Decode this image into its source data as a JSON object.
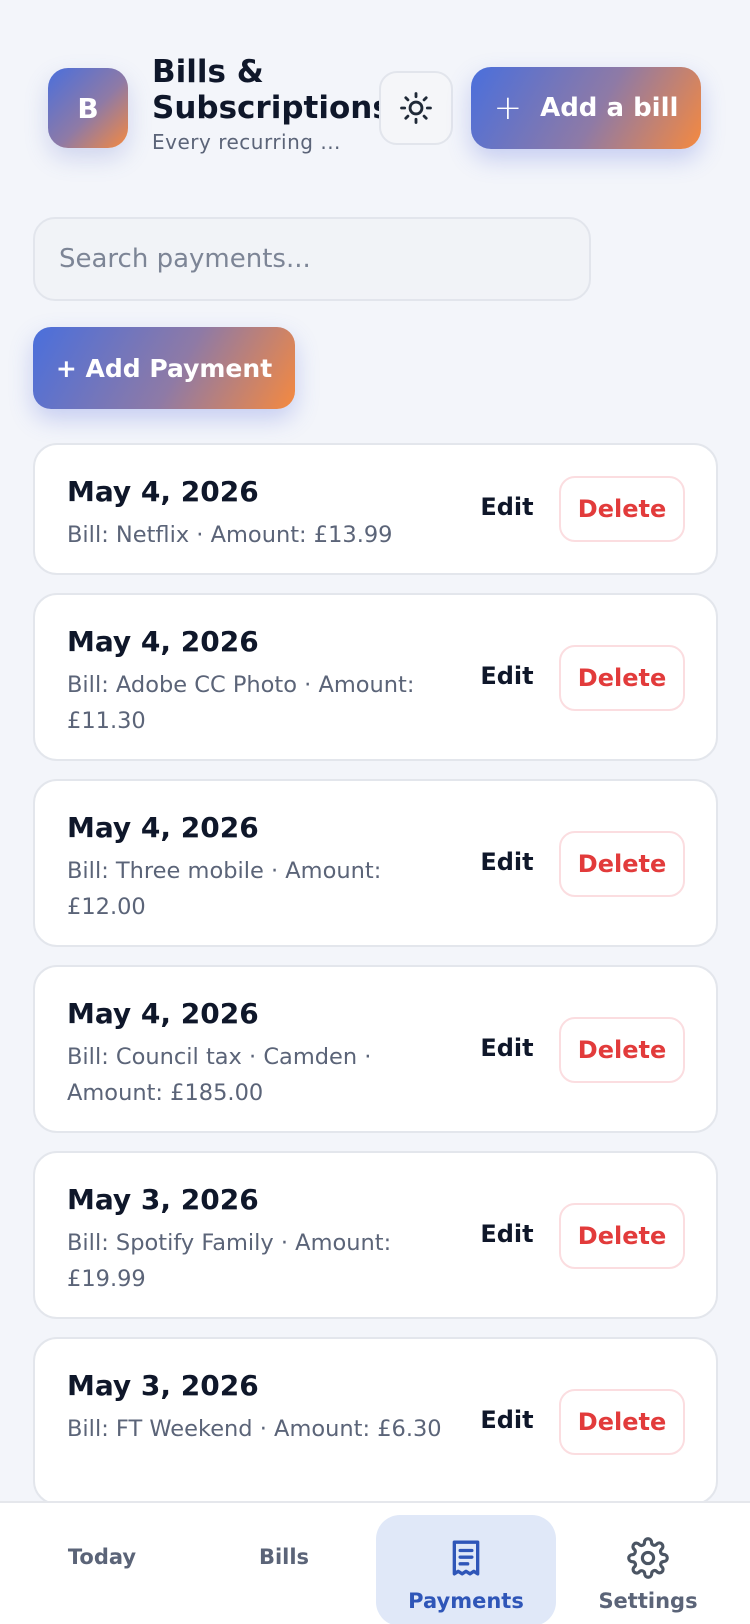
{
  "header": {
    "logo_letter": "B",
    "title": "Bills & Subscriptions",
    "subtitle": "Every recurring ...",
    "theme_toggle_icon": "sun-icon",
    "add_bill_label": "Add a bill"
  },
  "search": {
    "placeholder": "Search payments...",
    "value": ""
  },
  "add_payment_label": "+ Add Payment",
  "payments": [
    {
      "date": "May 4, 2026",
      "detail": "Bill: Netflix · Amount: £13.99",
      "edit": "Edit",
      "delete": "Delete"
    },
    {
      "date": "May 4, 2026",
      "detail": "Bill: Adobe CC Photo · Amount: £11.30",
      "edit": "Edit",
      "delete": "Delete"
    },
    {
      "date": "May 4, 2026",
      "detail": "Bill: Three mobile · Amount: £12.00",
      "edit": "Edit",
      "delete": "Delete"
    },
    {
      "date": "May 4, 2026",
      "detail": "Bill: Council tax · Camden · Amount: £185.00",
      "edit": "Edit",
      "delete": "Delete"
    },
    {
      "date": "May 3, 2026",
      "detail": "Bill: Spotify Family · Amount: £19.99",
      "edit": "Edit",
      "delete": "Delete"
    },
    {
      "date": "May 3, 2026",
      "detail": "Bill: FT Weekend · Amount: £6.30",
      "edit": "Edit",
      "delete": "Delete"
    }
  ],
  "nav": {
    "today": "Today",
    "bills": "Bills",
    "payments": "Payments",
    "settings": "Settings",
    "active": "payments"
  },
  "colors": {
    "accent_start": "#4a6fdc",
    "accent_end": "#f5893f",
    "delete": "#e23b3b",
    "active_nav": "#2f56b8"
  }
}
